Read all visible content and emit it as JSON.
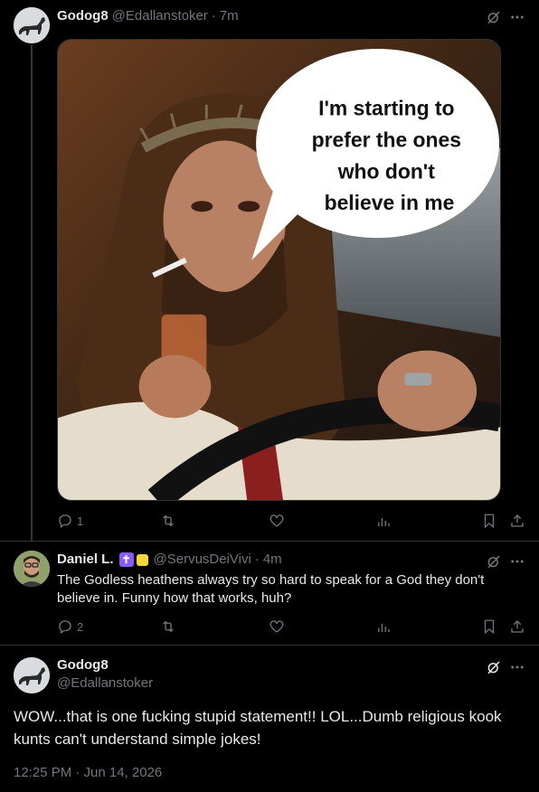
{
  "colors": {
    "background": "#000000",
    "text_primary": "#e7e9ea",
    "text_secondary": "#71767b",
    "divider": "#2f3336"
  },
  "post": {
    "author_name": "Godog8",
    "handle": "@Edallanstoker",
    "separator": "·",
    "time": "7m",
    "media_alt_text": "I'm starting to prefer the ones who don't believe in me",
    "media_caption_lines": [
      "I'm starting to",
      "prefer the ones",
      "who don't",
      "believe in me"
    ],
    "actions": {
      "replies": "1",
      "reposts": "",
      "likes": "",
      "views": ""
    }
  },
  "reply": {
    "author_name": "Daniel L.",
    "badges": [
      "cross-badge",
      "yellow-flag-badge"
    ],
    "handle": "@ServusDeiVivi",
    "separator": "·",
    "time": "4m",
    "text": "The Godless heathens always try so hard to speak for a God they don't believe in. Funny how that works, huh?",
    "actions": {
      "replies": "2",
      "reposts": "",
      "likes": "",
      "views": ""
    }
  },
  "main_post": {
    "author_name": "Godog8",
    "handle": "@Edallanstoker",
    "text": "WOW...that is one fucking stupid statement!! LOL...Dumb religious kook kunts can't understand simple jokes!",
    "timestamp": "12:25 PM · Jun 14, 2026"
  },
  "icons": {
    "grok": "grok-icon",
    "more": "more-icon",
    "reply": "reply-icon",
    "repost": "repost-icon",
    "like": "like-icon",
    "views": "views-icon",
    "bookmark": "bookmark-icon",
    "share": "share-icon"
  }
}
